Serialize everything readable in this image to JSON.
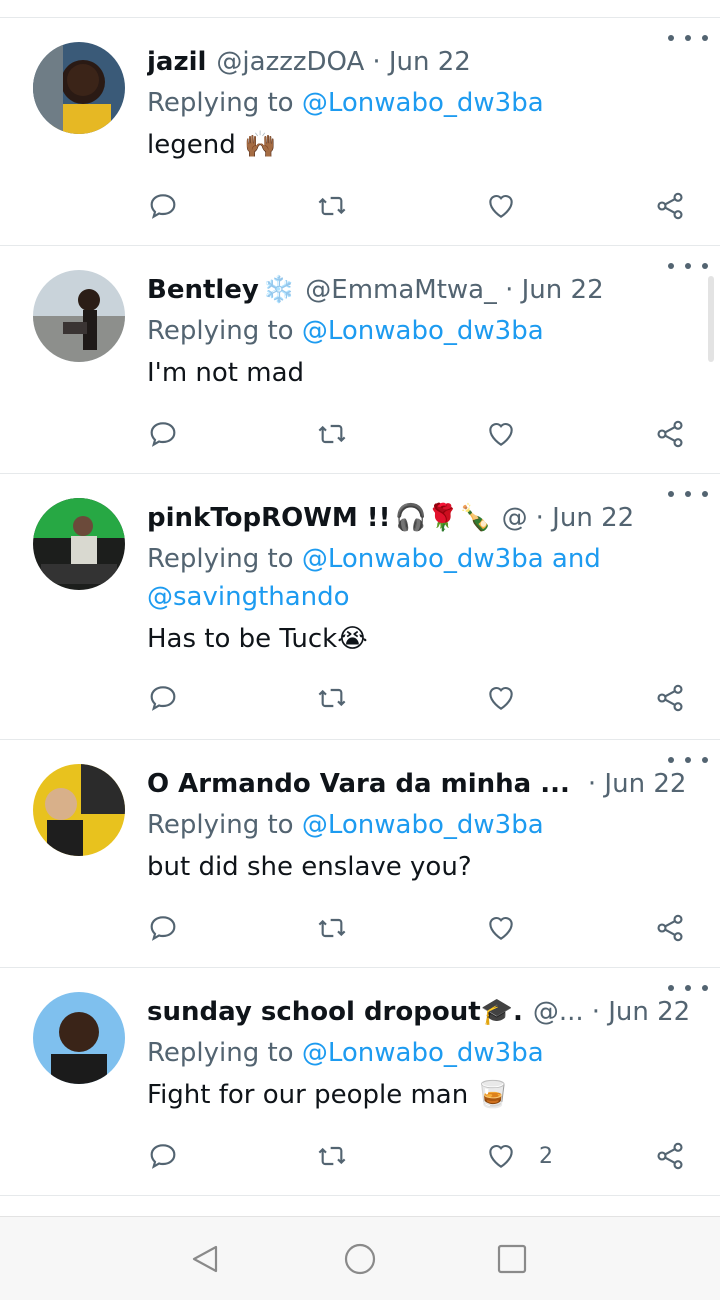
{
  "tweets": [
    {
      "name": "jazil",
      "name_emoji": "",
      "handle": "@jazzzDOA",
      "date": "· Jun 22",
      "replying_prefix": "Replying to ",
      "mentions": "@Lonwabo_dw3ba",
      "mentions_line2": "",
      "text": "legend 🙌🏾",
      "likes": ""
    },
    {
      "name": "Bentley",
      "name_emoji": "❄️",
      "handle": "@EmmaMtwa_",
      "date": "· Jun 22",
      "replying_prefix": "Replying to ",
      "mentions": "@Lonwabo_dw3ba",
      "mentions_line2": "",
      "text": "I'm not mad",
      "likes": ""
    },
    {
      "name": "pinkTopROWM !!",
      "name_emoji": "🎧🌹🍾",
      "handle": "@",
      "date": "· Jun 22",
      "replying_prefix": "Replying to ",
      "mentions": "@Lonwabo_dw3ba and",
      "mentions_line2": "@savingthando",
      "text": "Has to be Tuck😭",
      "likes": ""
    },
    {
      "name": "O Armando Vara da minha ...",
      "name_emoji": "",
      "handle": "",
      "date": "· Jun 22",
      "replying_prefix": "Replying to ",
      "mentions": "@Lonwabo_dw3ba",
      "mentions_line2": "",
      "text": "but did she enslave you?",
      "likes": ""
    },
    {
      "name": "sunday school dropout🎓.",
      "name_emoji": "",
      "handle": "@...",
      "date": "· Jun 22",
      "replying_prefix": "Replying to ",
      "mentions": "@Lonwabo_dw3ba",
      "mentions_line2": "",
      "text": "Fight for our people man 🥃",
      "likes": "2"
    }
  ],
  "colors": {
    "link": "#1d9bf0",
    "secondary": "#536471",
    "primary": "#0f1419",
    "navbar": "#f7f7f7"
  },
  "icons": [
    "reply-icon",
    "retweet-icon",
    "like-icon",
    "share-icon",
    "more-icon",
    "back-icon",
    "home-icon",
    "recents-icon"
  ]
}
